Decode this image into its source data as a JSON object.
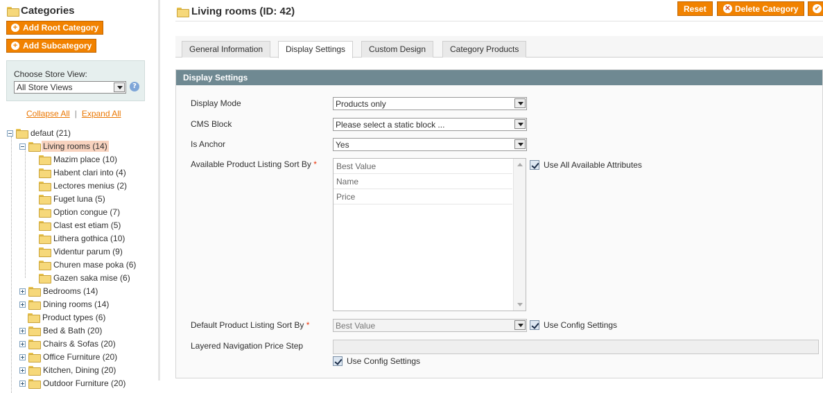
{
  "sidebar": {
    "title": "Categories",
    "add_root_label": "Add Root Category",
    "add_sub_label": "Add Subcategory",
    "store_view_label": "Choose Store View:",
    "store_view_value": "All Store Views",
    "collapse_all": "Collapse All",
    "separator": "|",
    "expand_all": "Expand All",
    "tree": [
      {
        "label": "defaut (21)"
      },
      {
        "label": "Living rooms (14)"
      },
      {
        "label": "Mazim place (10)"
      },
      {
        "label": "Habent clari into (4)"
      },
      {
        "label": "Lectores menius (2)"
      },
      {
        "label": "Fuget luna (5)"
      },
      {
        "label": "Option congue (7)"
      },
      {
        "label": "Clast est etiam (5)"
      },
      {
        "label": "Lithera gothica (10)"
      },
      {
        "label": "Videntur parum (9)"
      },
      {
        "label": "Churen mase poka (6)"
      },
      {
        "label": "Gazen saka mise (6)"
      },
      {
        "label": "Bedrooms (14)"
      },
      {
        "label": "Dining rooms (14)"
      },
      {
        "label": "Product types (6)"
      },
      {
        "label": "Bed & Bath (20)"
      },
      {
        "label": "Chairs & Sofas (20)"
      },
      {
        "label": "Office Furniture (20)"
      },
      {
        "label": "Kitchen, Dining (20)"
      },
      {
        "label": "Outdoor Furniture (20)"
      }
    ]
  },
  "header": {
    "title": "Living rooms (ID: 42)",
    "reset_label": "Reset",
    "delete_label": "Delete Category"
  },
  "tabs": [
    {
      "label": "General Information"
    },
    {
      "label": "Display Settings"
    },
    {
      "label": "Custom Design"
    },
    {
      "label": "Category Products"
    }
  ],
  "section": {
    "title": "Display Settings",
    "display_mode_label": "Display Mode",
    "display_mode_value": "Products only",
    "cms_block_label": "CMS Block",
    "cms_block_value": "Please select a static block ...",
    "is_anchor_label": "Is Anchor",
    "is_anchor_value": "Yes",
    "sort_by_label": "Available Product Listing Sort By",
    "required_mark": "*",
    "sort_options": [
      "Best Value",
      "Name",
      "Price"
    ],
    "use_all_attrs_label": "Use All Available Attributes",
    "default_sort_label": "Default Product Listing Sort By",
    "default_sort_value": "Best Value",
    "use_config_label": "Use Config Settings",
    "price_step_label": "Layered Navigation Price Step",
    "price_step_value": "",
    "use_config_label_2": "Use Config Settings"
  },
  "colors": {
    "accent": "#f18200",
    "section_header": "#6f8992",
    "selected_node": "#f8d3bf",
    "link": "#ea7601"
  }
}
